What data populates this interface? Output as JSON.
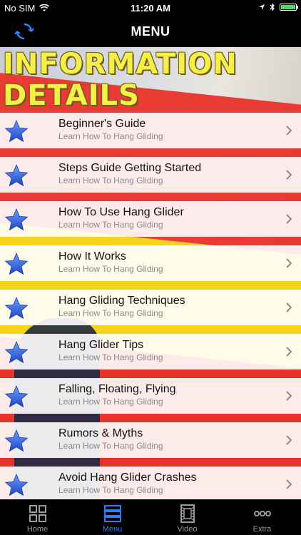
{
  "status": {
    "carrier": "No SIM",
    "time": "11:20 AM"
  },
  "nav": {
    "title": "MENU"
  },
  "header": {
    "line1": "INFORMATION",
    "line2": "DETAILS"
  },
  "items": [
    {
      "title": "Beginner's Guide",
      "subtitle": "Learn How To Hang Gliding"
    },
    {
      "title": "Steps Guide Getting Started",
      "subtitle": "Learn How To Hang Gliding"
    },
    {
      "title": "How To Use Hang Glider",
      "subtitle": "Learn How To Hang Gliding"
    },
    {
      "title": "How It Works",
      "subtitle": "Learn How To Hang Gliding"
    },
    {
      "title": "Hang Gliding Techniques",
      "subtitle": "Learn How To Hang Gliding"
    },
    {
      "title": "Hang Glider Tips",
      "subtitle": "Learn How To Hang Gliding"
    },
    {
      "title": "Falling, Floating, Flying",
      "subtitle": "Learn How To Hang Gliding"
    },
    {
      "title": "Rumors & Myths",
      "subtitle": "Learn How To Hang Gliding"
    },
    {
      "title": "Avoid Hang Glider Crashes",
      "subtitle": "Learn How To Hang Gliding"
    }
  ],
  "tabs": [
    {
      "label": "Home",
      "icon": "grid-icon"
    },
    {
      "label": "Menu",
      "icon": "list-icon"
    },
    {
      "label": "Video",
      "icon": "film-icon"
    },
    {
      "label": "Extra",
      "icon": "more-icon"
    }
  ],
  "colors": {
    "accent": "#2a7fff",
    "headline": "#f6ef4a",
    "star": "#2f5fd6"
  }
}
